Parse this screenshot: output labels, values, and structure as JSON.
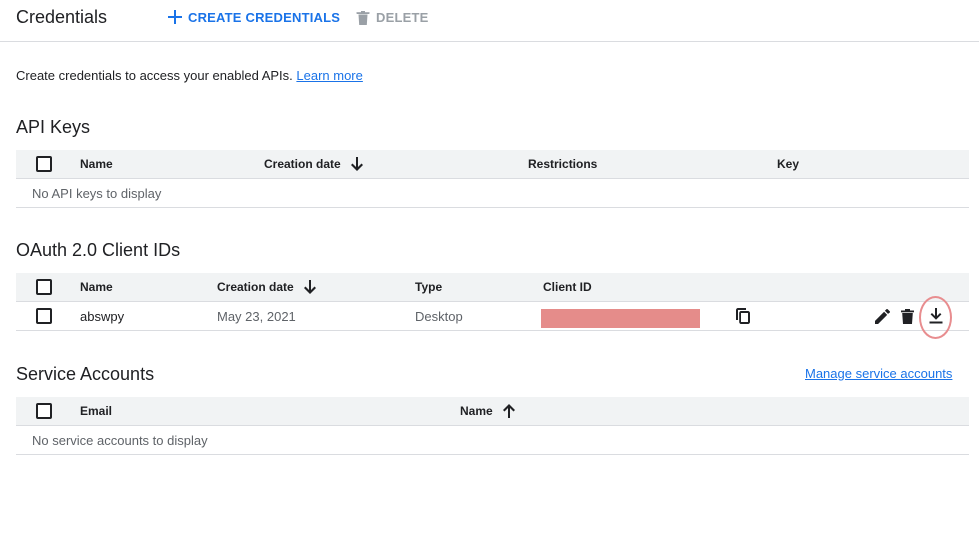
{
  "header": {
    "title": "Credentials",
    "create_label": "CREATE CREDENTIALS",
    "delete_label": "DELETE"
  },
  "intro": {
    "text": "Create credentials to access your enabled APIs.",
    "link": "Learn more"
  },
  "api_keys": {
    "title": "API Keys",
    "columns": [
      "Name",
      "Creation date",
      "Restrictions",
      "Key"
    ],
    "empty_text": "No API keys to display"
  },
  "oauth": {
    "title": "OAuth 2.0 Client IDs",
    "columns": [
      "Name",
      "Creation date",
      "Type",
      "Client ID"
    ],
    "rows": [
      {
        "name": "abswpy",
        "creation_date": "May 23, 2021",
        "type": "Desktop"
      }
    ]
  },
  "service_accounts": {
    "title": "Service Accounts",
    "manage_link": "Manage service accounts",
    "columns": [
      "Email",
      "Name"
    ],
    "empty_text": "No service accounts to display"
  },
  "colors": {
    "accent": "#1a73e8",
    "redaction": "#e58c8a",
    "highlight": "#e88d8f"
  }
}
